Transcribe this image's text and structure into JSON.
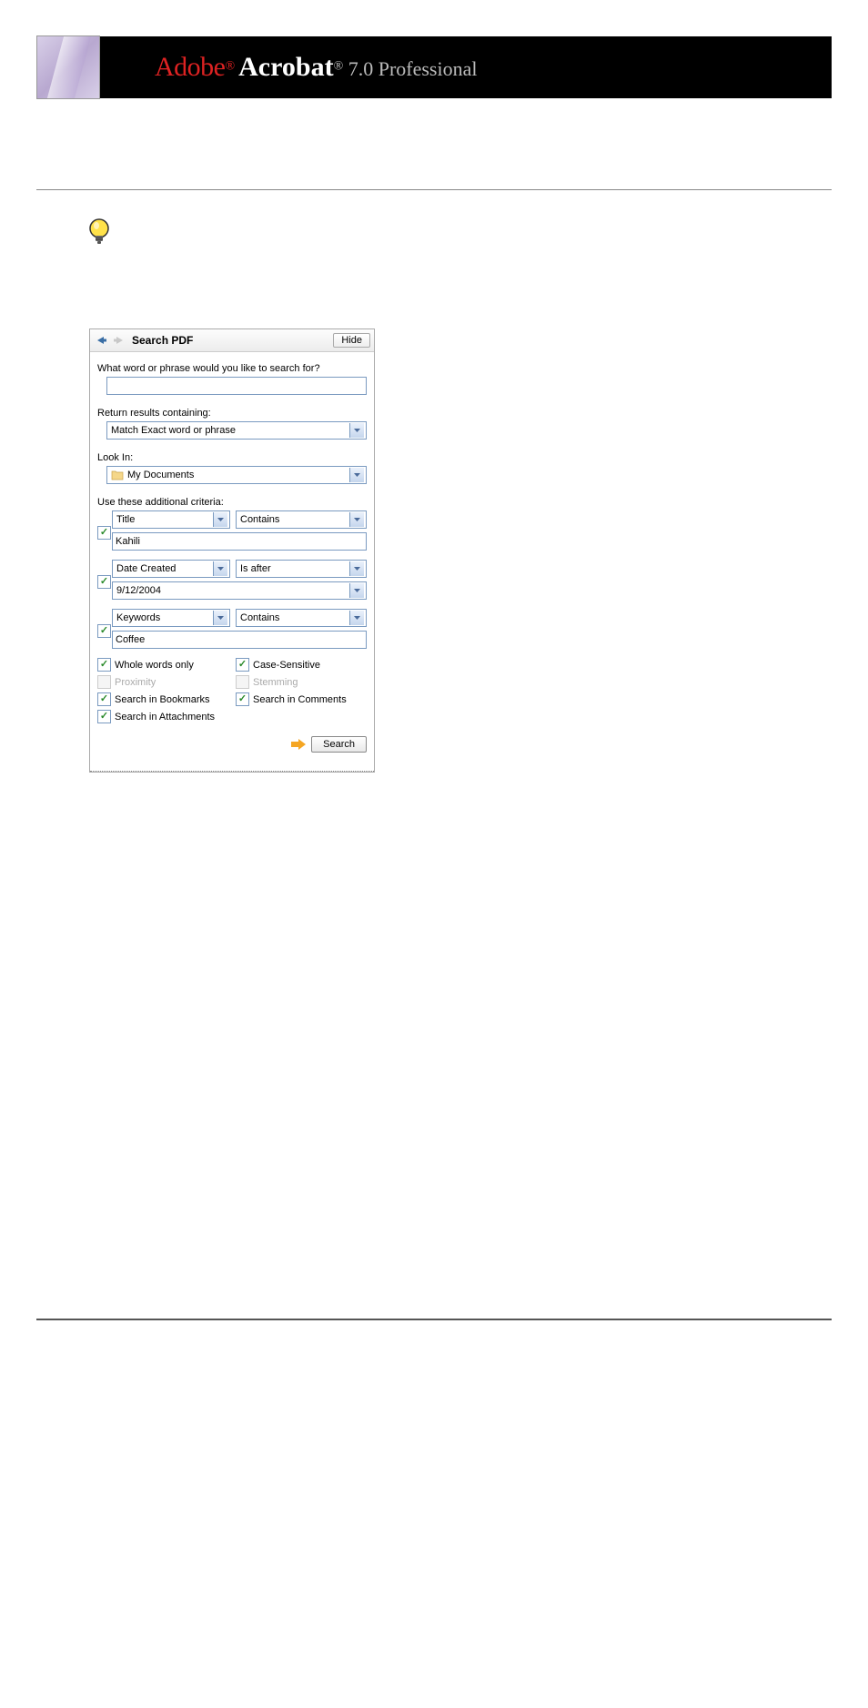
{
  "banner": {
    "adobe": "Adobe",
    "acrobat": "Acrobat",
    "reg1": "®",
    "reg2": "®",
    "version": " 7.0 Professional"
  },
  "panel": {
    "title": "Search PDF",
    "hide": "Hide",
    "q_label": "What word or phrase would you like to search for?",
    "q_value": "",
    "return_label": "Return results containing:",
    "return_value": "Match Exact word or phrase",
    "lookin_label": "Look In:",
    "lookin_value": "My Documents",
    "criteria_label": "Use these additional criteria:",
    "criteria": [
      {
        "checked": true,
        "field": "Title",
        "op": "Contains",
        "value": "Kahili",
        "value_is_select": false
      },
      {
        "checked": true,
        "field": "Date Created",
        "op": "Is after",
        "value": "9/12/2004",
        "value_is_select": true
      },
      {
        "checked": true,
        "field": "Keywords",
        "op": "Contains",
        "value": "Coffee",
        "value_is_select": false
      }
    ],
    "options": [
      {
        "label": "Whole words only",
        "checked": true,
        "disabled": false
      },
      {
        "label": "Case-Sensitive",
        "checked": true,
        "disabled": false
      },
      {
        "label": "Proximity",
        "checked": false,
        "disabled": true
      },
      {
        "label": "Stemming",
        "checked": false,
        "disabled": true
      },
      {
        "label": "Search in Bookmarks",
        "checked": true,
        "disabled": false
      },
      {
        "label": "Search in Comments",
        "checked": true,
        "disabled": false
      },
      {
        "label": "Search in Attachments",
        "checked": true,
        "disabled": false
      }
    ],
    "search_btn": "Search"
  }
}
